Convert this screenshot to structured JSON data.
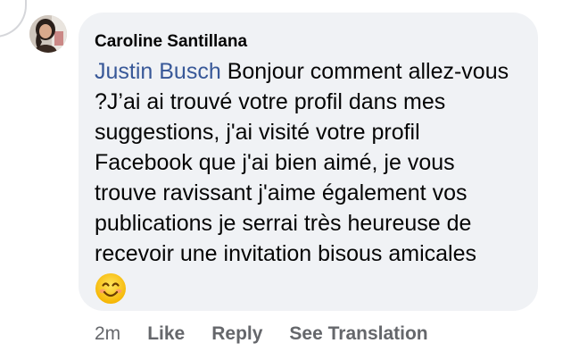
{
  "comment": {
    "author": "Caroline Santillana",
    "mention": "Justin Busch",
    "text": " Bonjour comment allez-vous ?J’ai ai trouvé votre profil dans mes suggestions, j'ai visité votre profil Facebook que j'ai bien aimé, je vous trouve ravissant j'aime également vos publications je serrai très heureuse de recevoir une invitation bisous amicales",
    "emoji": "smiling-face-emoji",
    "timestamp": "2m"
  },
  "actions": {
    "like": "Like",
    "reply": "Reply",
    "see_translation": "See Translation"
  },
  "colors": {
    "bubble": "#f0f2f5",
    "mention": "#385898",
    "text": "#050505",
    "meta": "#65676b"
  }
}
